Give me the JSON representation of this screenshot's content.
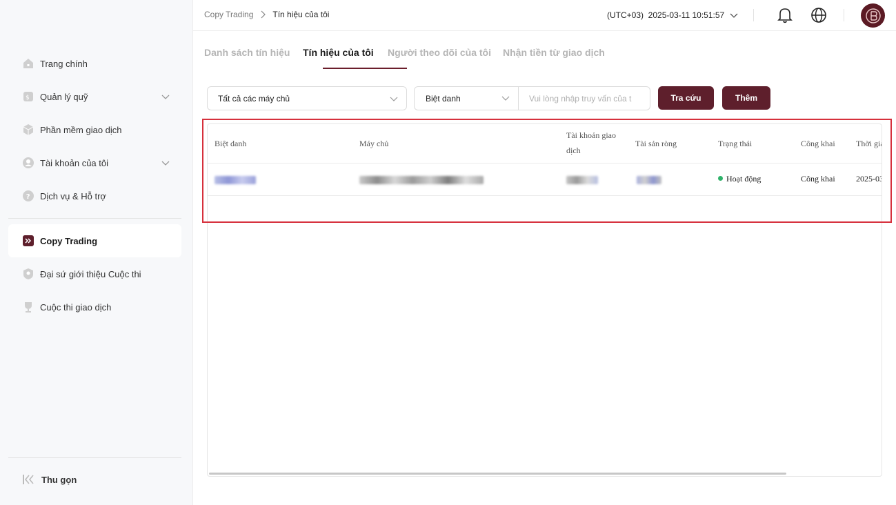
{
  "sidebar": {
    "items": [
      {
        "label": "Trang chính",
        "icon": "home-icon"
      },
      {
        "label": "Quản lý quỹ",
        "icon": "fund-icon",
        "expandable": true
      },
      {
        "label": "Phần mềm giao dịch",
        "icon": "box-icon"
      },
      {
        "label": "Tài khoản của tôi",
        "icon": "user-icon",
        "expandable": true
      },
      {
        "label": "Dịch vụ & Hỗ trợ",
        "icon": "help-icon"
      },
      {
        "label": "Copy Trading",
        "icon": "copy-trading-icon",
        "active": true
      },
      {
        "label": "Đại sứ giới thiệu Cuộc thi",
        "icon": "ambassador-icon"
      },
      {
        "label": "Cuộc thi giao dịch",
        "icon": "trophy-icon"
      }
    ],
    "collapse_label": "Thu gọn"
  },
  "header": {
    "breadcrumb": [
      "Copy Trading",
      "Tín hiệu của tôi"
    ],
    "timezone_time": "(UTC+03)  2025-03-11 10:51:57"
  },
  "tabs": [
    {
      "label": "Danh sách tín hiệu",
      "active": false
    },
    {
      "label": "Tín hiệu của tôi",
      "active": true
    },
    {
      "label": "Người theo dõi của tôi",
      "active": false
    },
    {
      "label": "Nhận tiền từ giao dịch",
      "active": false
    }
  ],
  "filters": {
    "server_select": "Tất cả các máy chủ",
    "field_select": "Biệt danh",
    "search_placeholder": "Vui lòng nhập truy vấn của t",
    "search_button": "Tra cứu",
    "add_button": "Thêm"
  },
  "table": {
    "columns": [
      "Biệt danh",
      "Máy chủ",
      "Tài khoản giao dịch",
      "Tài sản ròng",
      "Trạng thái",
      "Công khai",
      "Thời gia"
    ],
    "rows": [
      {
        "status": "Hoạt động",
        "public": "Công khai",
        "time": "2025-03"
      }
    ]
  },
  "colors": {
    "brand": "#5e1f2c",
    "status_active": "#2fb26a",
    "highlight": "#d6303c"
  }
}
